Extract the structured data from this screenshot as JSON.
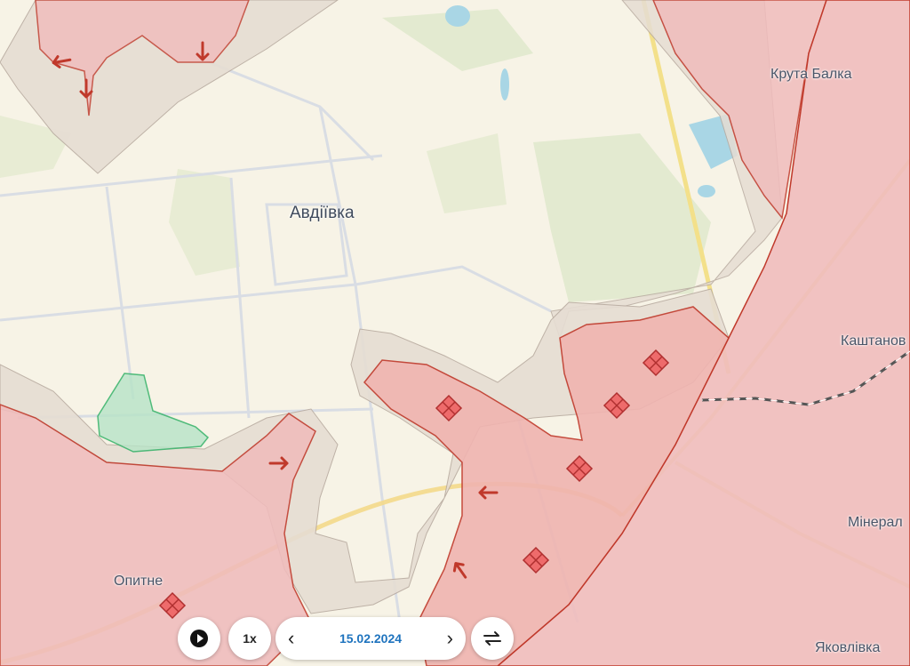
{
  "map": {
    "places": [
      {
        "id": "avdiivka",
        "label": "Авдіївка"
      },
      {
        "id": "kruta-balka",
        "label": "Крута Балка"
      },
      {
        "id": "kashtanove",
        "label": "Каштанов"
      },
      {
        "id": "mineralne",
        "label": "Мінерал"
      },
      {
        "id": "opytne",
        "label": "Опитне"
      },
      {
        "id": "yakovlivka",
        "label": "Яковлівка"
      }
    ],
    "colors": {
      "background": "#f7f3e6",
      "occupied_fill": "#f0bcbc",
      "occupied_border": "#c0392b",
      "contested_fill": "#e8dcd2",
      "liberated_fill": "#b7e4c7",
      "liberated_border": "#27ae60",
      "marker": "#ee6b6b"
    },
    "icons": [
      "attack-arrow-icon",
      "battle-marker-icon"
    ]
  },
  "controls": {
    "play_icon": "play-icon",
    "speed_label": "1x",
    "prev_icon": "chevron-left-icon",
    "date": "15.02.2024",
    "next_icon": "chevron-right-icon",
    "swap_icon": "swap-arrows-icon"
  }
}
